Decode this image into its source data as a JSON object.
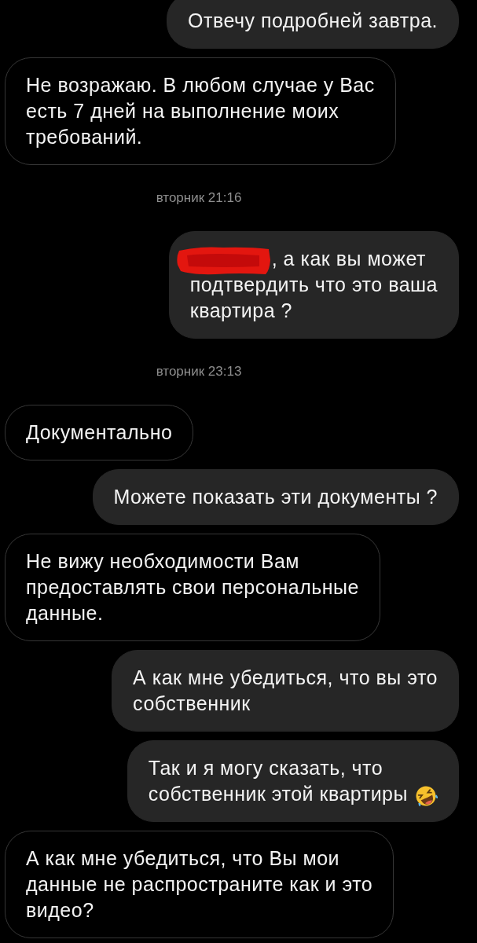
{
  "messages": [
    {
      "kind": "sent",
      "text": "Отвечу подробней завтра."
    },
    {
      "kind": "received",
      "text": "Не возражаю. В любом случае у Вас\nесть 7 дней на выполнение моих\nтребований."
    },
    {
      "kind": "timestamp",
      "text": "вторник 21:16"
    },
    {
      "kind": "sent",
      "redacted_prefix": true,
      "text": ", а как вы может\nподтвердить что это ваша\nквартира ?"
    },
    {
      "kind": "timestamp",
      "text": "вторник 23:13"
    },
    {
      "kind": "received",
      "text": "Документально"
    },
    {
      "kind": "sent",
      "text": "Можете показать эти документы ?"
    },
    {
      "kind": "received",
      "text": "Не вижу необходимости Вам\nпредоставлять свои персональные\nданные."
    },
    {
      "kind": "sent",
      "text": "А как мне убедиться, что вы это\nсобственник"
    },
    {
      "kind": "sent",
      "trailing_emoji": true,
      "text": "Так и я могу сказать, что\nсобственник этой квартиры"
    },
    {
      "kind": "received",
      "text": "А как мне убедиться, что Вы мои\nданные не распространите как и это\nвидео?"
    }
  ]
}
